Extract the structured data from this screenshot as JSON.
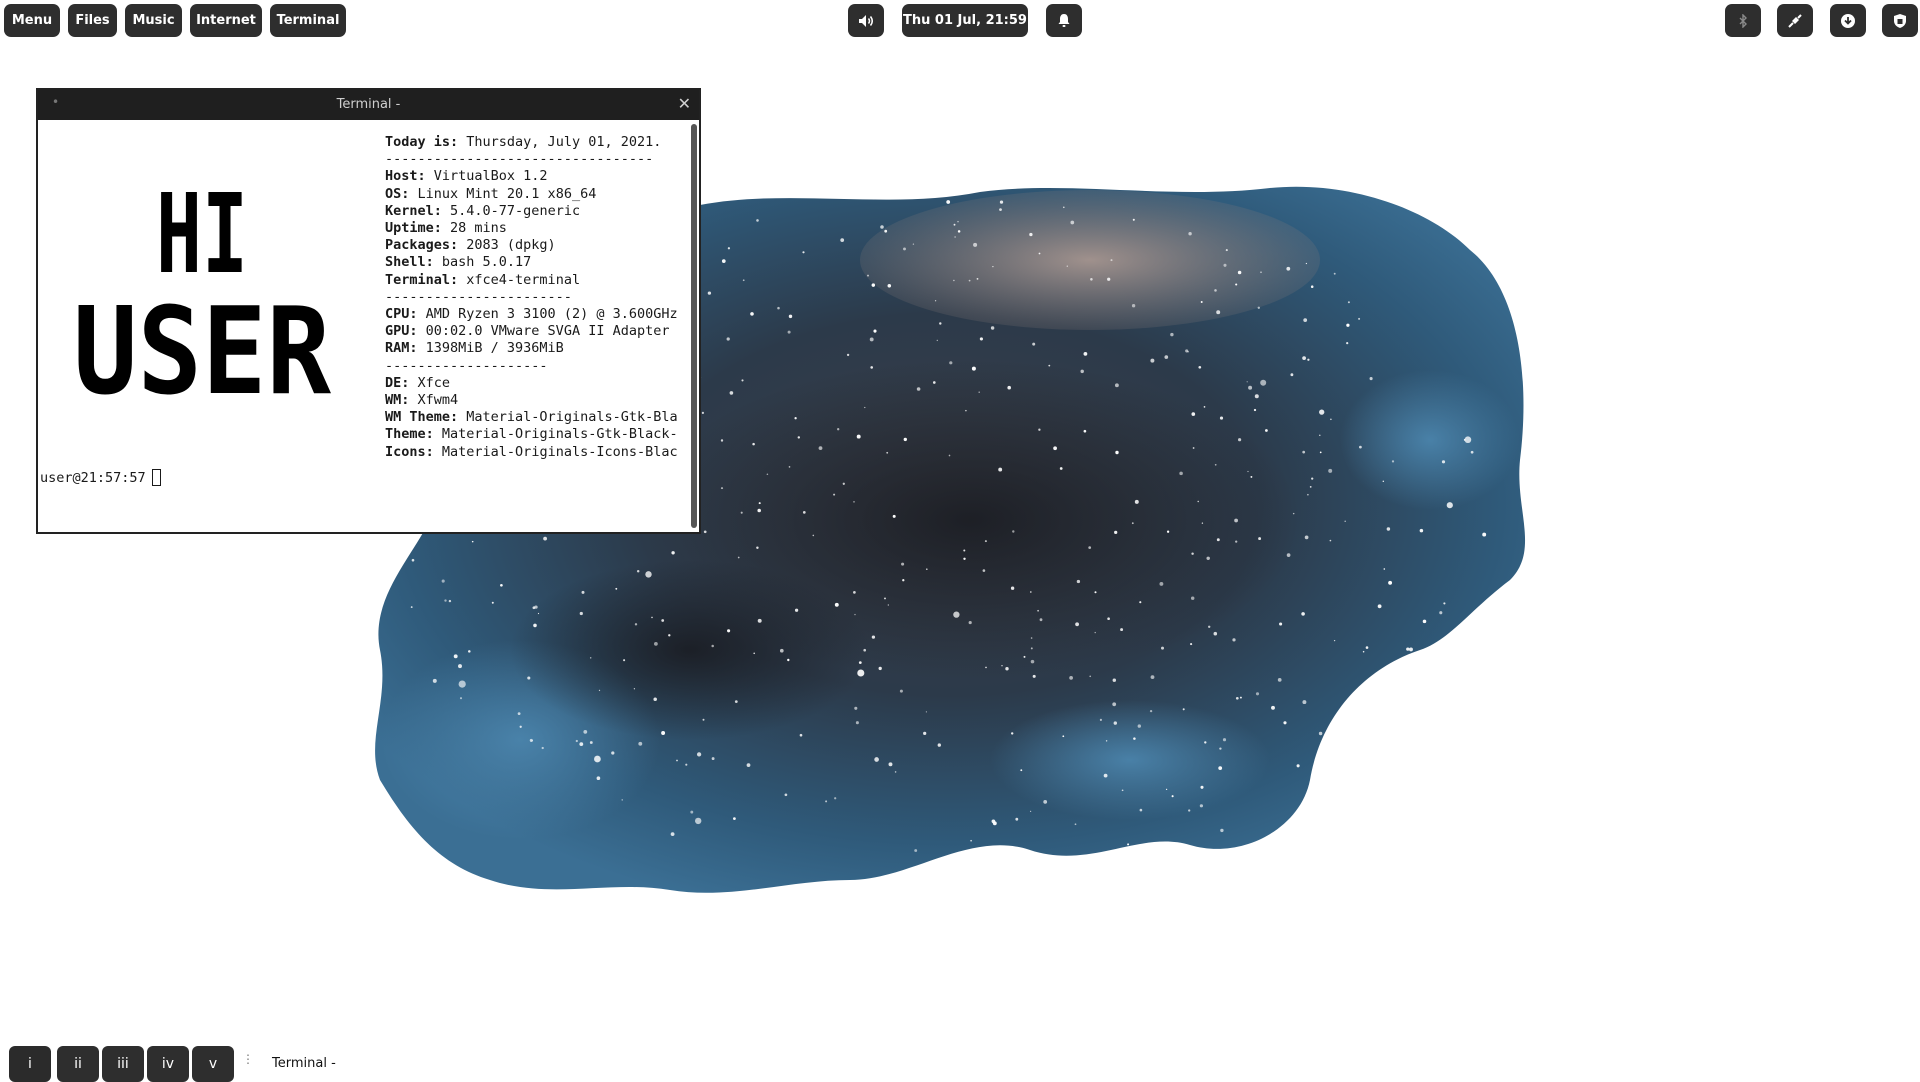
{
  "top_panel": {
    "apps": [
      {
        "label": "Menu"
      },
      {
        "label": "Files"
      },
      {
        "label": "Music"
      },
      {
        "label": "Internet"
      },
      {
        "label": "Terminal"
      }
    ],
    "volume_icon": "speaker-icon",
    "clock": "Thu 01 Jul, 21:59",
    "notification_icon": "bell-icon",
    "tray_icons": [
      "bluetooth-icon",
      "network-icon",
      "download-icon",
      "shield-icon"
    ]
  },
  "terminal": {
    "title": "Terminal -",
    "ascii_art": {
      "line1": "HI",
      "line2": "USER"
    },
    "info": {
      "today_label": "Today is:",
      "today_value": " Thursday, July 01, 2021.",
      "sep1": "---------------------------------",
      "host_label": "Host:",
      "host_value": " VirtualBox 1.2",
      "os_label": "OS:",
      "os_value": " Linux Mint 20.1 x86_64",
      "kernel_label": "Kernel:",
      "kernel_value": " 5.4.0-77-generic",
      "uptime_label": "Uptime:",
      "uptime_value": " 28 mins",
      "packages_label": "Packages:",
      "packages_value": " 2083 (dpkg)",
      "shell_label": "Shell:",
      "shell_value": " bash 5.0.17",
      "terminal_label": "Terminal:",
      "terminal_value": " xfce4-terminal",
      "sep2": "-----------------------",
      "cpu_label": "CPU:",
      "cpu_value": " AMD Ryzen 3 3100 (2) @ 3.600GHz",
      "gpu_label": "GPU:",
      "gpu_value": " 00:02.0 VMware SVGA II Adapter",
      "ram_label": "RAM:",
      "ram_value": " 1398MiB / 3936MiB",
      "sep3": "--------------------",
      "de_label": "DE:",
      "de_value": " Xfce",
      "wm_label": "WM:",
      "wm_value": " Xfwm4",
      "wmtheme_label": "WM Theme:",
      "wmtheme_value": " Material-Originals-Gtk-Bla",
      "theme_label": "Theme:",
      "theme_value": " Material-Originals-Gtk-Black-",
      "icons_label": "Icons:",
      "icons_value": " Material-Originals-Icons-Blac"
    },
    "prompt": "user@21:57:57"
  },
  "bottom_panel": {
    "workspaces": [
      "i",
      "ii",
      "iii",
      "iv",
      "v"
    ],
    "task_label": "Terminal -"
  },
  "colors": {
    "panel_button": "#2e2e2e",
    "panel_text": "#ffffff",
    "titlebar": "#1f1f1f",
    "desktop_bg": "#ffffff"
  }
}
